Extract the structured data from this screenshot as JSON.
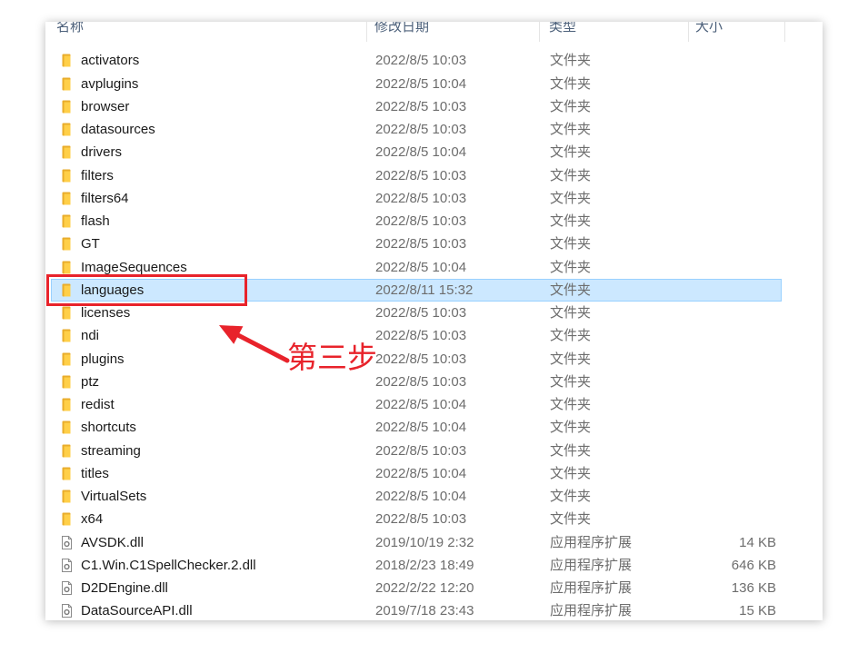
{
  "columns": {
    "name": "名称",
    "modified": "修改日期",
    "type": "类型",
    "size": "大小"
  },
  "files": [
    {
      "name": "activators",
      "modified": "2022/8/5 10:03",
      "type": "文件夹",
      "icon": "folder-icon"
    },
    {
      "name": "avplugins",
      "modified": "2022/8/5 10:04",
      "type": "文件夹",
      "icon": "folder-icon"
    },
    {
      "name": "browser",
      "modified": "2022/8/5 10:03",
      "type": "文件夹",
      "icon": "folder-icon"
    },
    {
      "name": "datasources",
      "modified": "2022/8/5 10:03",
      "type": "文件夹",
      "icon": "folder-icon"
    },
    {
      "name": "drivers",
      "modified": "2022/8/5 10:04",
      "type": "文件夹",
      "icon": "folder-icon"
    },
    {
      "name": "filters",
      "modified": "2022/8/5 10:03",
      "type": "文件夹",
      "icon": "folder-icon"
    },
    {
      "name": "filters64",
      "modified": "2022/8/5 10:03",
      "type": "文件夹",
      "icon": "folder-icon"
    },
    {
      "name": "flash",
      "modified": "2022/8/5 10:03",
      "type": "文件夹",
      "icon": "folder-icon"
    },
    {
      "name": "GT",
      "modified": "2022/8/5 10:03",
      "type": "文件夹",
      "icon": "folder-icon"
    },
    {
      "name": "ImageSequences",
      "modified": "2022/8/5 10:04",
      "type": "文件夹",
      "icon": "folder-icon"
    },
    {
      "name": "languages",
      "modified": "2022/8/11 15:32",
      "type": "文件夹",
      "icon": "folder-icon",
      "selected": true
    },
    {
      "name": "licenses",
      "modified": "2022/8/5 10:03",
      "type": "文件夹",
      "icon": "folder-icon"
    },
    {
      "name": "ndi",
      "modified": "2022/8/5 10:03",
      "type": "文件夹",
      "icon": "folder-icon"
    },
    {
      "name": "plugins",
      "modified": "2022/8/5 10:03",
      "type": "文件夹",
      "icon": "folder-icon"
    },
    {
      "name": "ptz",
      "modified": "2022/8/5 10:03",
      "type": "文件夹",
      "icon": "folder-icon"
    },
    {
      "name": "redist",
      "modified": "2022/8/5 10:04",
      "type": "文件夹",
      "icon": "folder-icon"
    },
    {
      "name": "shortcuts",
      "modified": "2022/8/5 10:04",
      "type": "文件夹",
      "icon": "folder-icon"
    },
    {
      "name": "streaming",
      "modified": "2022/8/5 10:03",
      "type": "文件夹",
      "icon": "folder-icon"
    },
    {
      "name": "titles",
      "modified": "2022/8/5 10:04",
      "type": "文件夹",
      "icon": "folder-icon"
    },
    {
      "name": "VirtualSets",
      "modified": "2022/8/5 10:04",
      "type": "文件夹",
      "icon": "folder-icon"
    },
    {
      "name": "x64",
      "modified": "2022/8/5 10:03",
      "type": "文件夹",
      "icon": "folder-icon"
    },
    {
      "name": "AVSDK.dll",
      "modified": "2019/10/19 2:32",
      "type": "应用程序扩展",
      "size": "14 KB",
      "icon": "dll-file-icon"
    },
    {
      "name": "C1.Win.C1SpellChecker.2.dll",
      "modified": "2018/2/23 18:49",
      "type": "应用程序扩展",
      "size": "646 KB",
      "icon": "dll-file-icon"
    },
    {
      "name": "D2DEngine.dll",
      "modified": "2022/2/22 12:20",
      "type": "应用程序扩展",
      "size": "136 KB",
      "icon": "dll-file-icon"
    },
    {
      "name": "DataSourceAPI.dll",
      "modified": "2019/7/18 23:43",
      "type": "应用程序扩展",
      "size": "15 KB",
      "icon": "dll-file-icon"
    }
  ],
  "annotation": {
    "step_label": "第三步"
  },
  "colors": {
    "annotation_red": "#e8232b",
    "selection_fill": "#cce8ff",
    "selection_border": "#99d1ff",
    "folder_yellow": "#ffcf48",
    "folder_shade": "#e9ad2c"
  }
}
